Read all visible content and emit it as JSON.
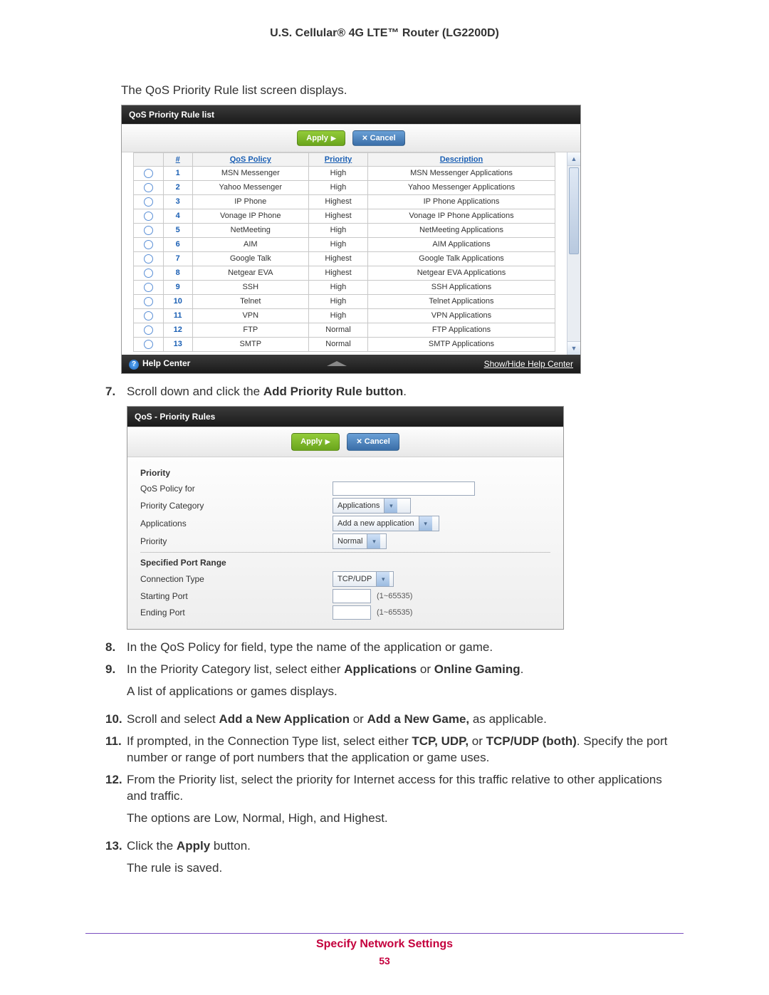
{
  "header_title": "U.S. Cellular® 4G LTE™ Router (LG2200D)",
  "intro_line": "The QoS Priority Rule list screen displays.",
  "shot1": {
    "title": "QoS Priority Rule list",
    "apply_label": "Apply",
    "cancel_label": "Cancel",
    "headers": {
      "num": "#",
      "policy": "QoS Policy",
      "priority": "Priority",
      "description": "Description"
    },
    "rows": [
      {
        "num": "1",
        "policy": "MSN Messenger",
        "priority": "High",
        "desc": "MSN Messenger Applications"
      },
      {
        "num": "2",
        "policy": "Yahoo Messenger",
        "priority": "High",
        "desc": "Yahoo Messenger Applications"
      },
      {
        "num": "3",
        "policy": "IP Phone",
        "priority": "Highest",
        "desc": "IP Phone Applications"
      },
      {
        "num": "4",
        "policy": "Vonage IP Phone",
        "priority": "Highest",
        "desc": "Vonage IP Phone Applications"
      },
      {
        "num": "5",
        "policy": "NetMeeting",
        "priority": "High",
        "desc": "NetMeeting Applications"
      },
      {
        "num": "6",
        "policy": "AIM",
        "priority": "High",
        "desc": "AIM Applications"
      },
      {
        "num": "7",
        "policy": "Google Talk",
        "priority": "Highest",
        "desc": "Google Talk Applications"
      },
      {
        "num": "8",
        "policy": "Netgear EVA",
        "priority": "Highest",
        "desc": "Netgear EVA Applications"
      },
      {
        "num": "9",
        "policy": "SSH",
        "priority": "High",
        "desc": "SSH Applications"
      },
      {
        "num": "10",
        "policy": "Telnet",
        "priority": "High",
        "desc": "Telnet Applications"
      },
      {
        "num": "11",
        "policy": "VPN",
        "priority": "High",
        "desc": "VPN Applications"
      },
      {
        "num": "12",
        "policy": "FTP",
        "priority": "Normal",
        "desc": "FTP Applications"
      },
      {
        "num": "13",
        "policy": "SMTP",
        "priority": "Normal",
        "desc": "SMTP Applications"
      }
    ],
    "help_center": "Help Center",
    "show_hide": "Show/Hide Help Center"
  },
  "steps": {
    "s7_num": "7.",
    "s7_a": "Scroll down and click the ",
    "s7_b": "Add Priority Rule button",
    "s7_c": ".",
    "s8_num": "8.",
    "s8": "In the QoS Policy for field, type the name of the application or game.",
    "s9_num": "9.",
    "s9_a": "In the Priority Category list, select either ",
    "s9_b": "Applications",
    "s9_c": " or ",
    "s9_d": "Online Gaming",
    "s9_e": ".",
    "s9_sub": "A list of applications or games displays.",
    "s10_num": "10.",
    "s10_a": "Scroll and select ",
    "s10_b": "Add a New Application",
    "s10_c": " or ",
    "s10_d": "Add a New Game,",
    "s10_e": " as applicable.",
    "s11_num": "11.",
    "s11_a": "If prompted, in the Connection Type list, select either ",
    "s11_b": "TCP, UDP,",
    "s11_c": " or ",
    "s11_d": "TCP/UDP (both)",
    "s11_e": ". Specify the port number or range of port numbers that the application or game uses.",
    "s12_num": "12.",
    "s12": "From the Priority list, select the priority for Internet access for this traffic relative to other applications and traffic.",
    "s12_sub": "The options are Low, Normal, High, and Highest.",
    "s13_num": "13.",
    "s13_a": "Click the ",
    "s13_b": "Apply",
    "s13_c": " button.",
    "s13_sub": "The rule is saved."
  },
  "shot2": {
    "title": "QoS - Priority Rules",
    "apply_label": "Apply",
    "cancel_label": "Cancel",
    "priority_heading": "Priority",
    "lbl_policy_for": "QoS Policy for",
    "lbl_category": "Priority Category",
    "lbl_applications": "Applications",
    "lbl_priority": "Priority",
    "val_category": "Applications",
    "val_applications": "Add a new application",
    "val_priority": "Normal",
    "port_heading": "Specified Port Range",
    "lbl_conn_type": "Connection Type",
    "val_conn_type": "TCP/UDP",
    "lbl_start_port": "Starting Port",
    "lbl_end_port": "Ending Port",
    "port_hint": "(1~65535)"
  },
  "footer": {
    "section": "Specify Network Settings",
    "page": "53"
  }
}
